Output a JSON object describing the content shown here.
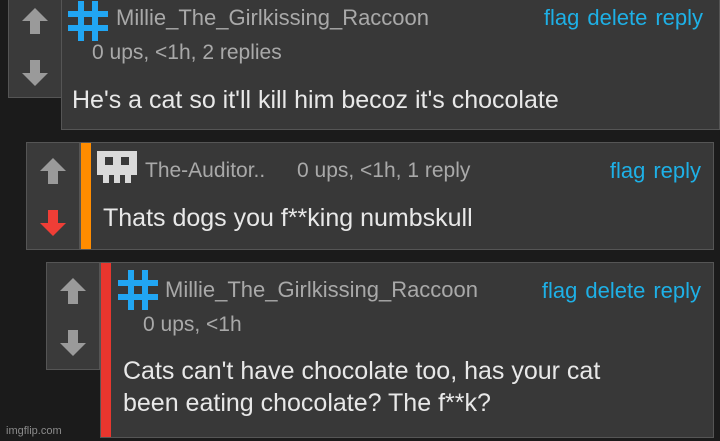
{
  "comments": [
    {
      "username": "Millie_The_Girlkissing_Raccoon",
      "meta": "0 ups, <1h, 2 replies",
      "actions": [
        "flag",
        "delete",
        "reply"
      ],
      "body": "He's a cat so it'll kill him becoz it's chocolate",
      "avatar_icon": "hashtag-icon",
      "vote_state": "none"
    },
    {
      "username": "The-Auditor..",
      "meta": "0 ups, <1h, 1 reply",
      "actions": [
        "flag",
        "reply"
      ],
      "body": "Thats dogs you f**king numbskull",
      "avatar_icon": "pixel-face-icon",
      "accent_color": "#ff8c00",
      "vote_state": "downvoted"
    },
    {
      "username": "Millie_The_Girlkissing_Raccoon",
      "meta": "0 ups, <1h",
      "actions": [
        "flag",
        "delete",
        "reply"
      ],
      "body_lines": [
        "Cats can't have chocolate too, has your cat",
        "been eating chocolate? The f**k?"
      ],
      "avatar_icon": "hashtag-icon",
      "accent_color": "#e8362e",
      "vote_state": "none"
    }
  ],
  "colors": {
    "link": "#1eb0e6",
    "hashtag_avatar": "#21a6f3",
    "downvote_active": "#ef3e36",
    "arrow_inactive": "#9a9a9a"
  },
  "watermark": "imgflip.com"
}
